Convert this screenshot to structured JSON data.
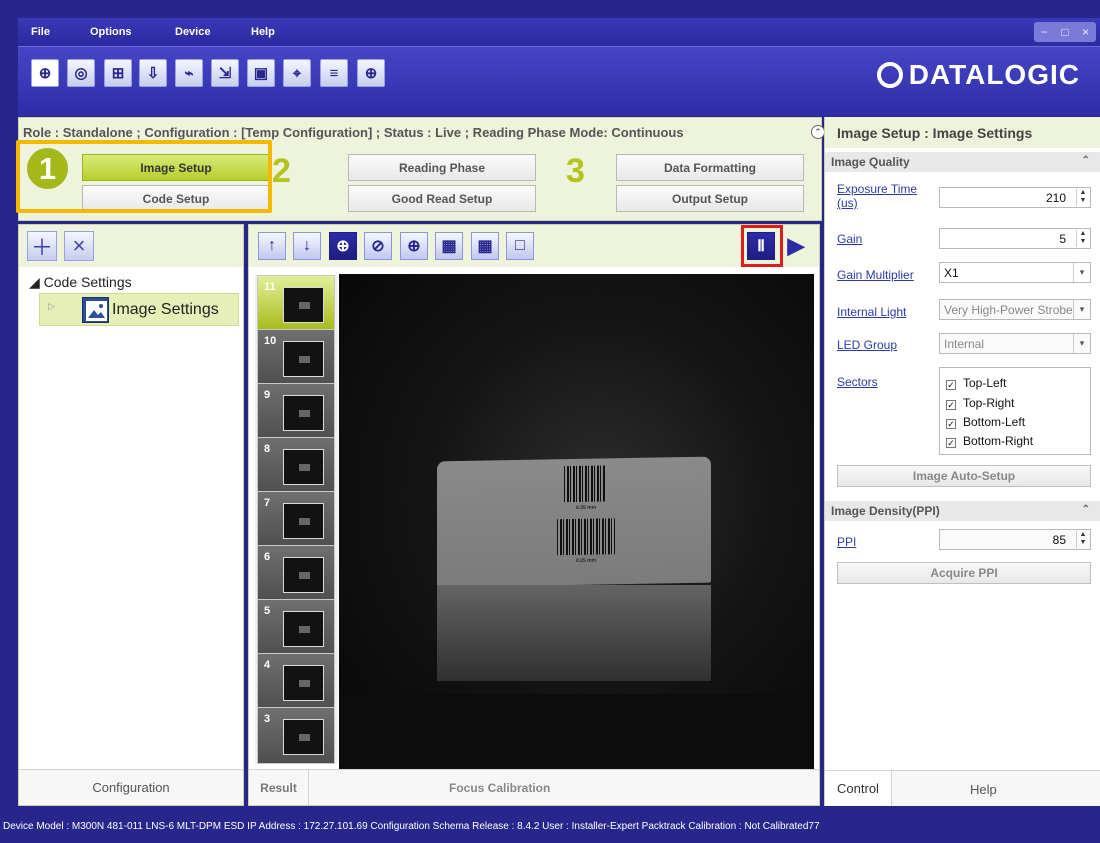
{
  "menu": [
    "File",
    "Options",
    "Device",
    "Help"
  ],
  "toolbar": {
    "icons": [
      "connect-icon",
      "camera-icon",
      "add-image-icon",
      "download-image-icon",
      "save-image-icon",
      "export-icon",
      "settings-icon",
      "camera-settings-icon",
      "diagnostics-icon",
      "target-icon"
    ],
    "logo": "DATALOGIC"
  },
  "role_line": "Role : Standalone ; Configuration : [Temp Configuration] ; Status : Live ; Reading Phase Mode: Continuous",
  "steps": {
    "step1": {
      "number": "1",
      "primary": "Image Setup",
      "secondary": "Code Setup"
    },
    "step2": {
      "number": "2",
      "primary": "Reading Phase",
      "secondary": "Good Read Setup"
    },
    "step3": {
      "number": "3",
      "primary": "Data Formatting",
      "secondary": "Output Setup"
    }
  },
  "left_panel": {
    "tree_root": "◢ Code Settings",
    "tree_child": "Image Settings",
    "footer": "Configuration"
  },
  "center_panel": {
    "thumb_labels": [
      "11",
      "10",
      "9",
      "8",
      "7",
      "6",
      "5",
      "4",
      "3"
    ],
    "tabs": {
      "result": "Result",
      "focus": "Focus Calibration"
    },
    "barcode_labels": [
      "0.35 mm",
      "0.25 mm"
    ]
  },
  "right_panel": {
    "title": "Image Setup : Image Settings",
    "image_quality": {
      "title": "Image Quality",
      "exposure_label": "Exposure Time (us)",
      "exposure_value": "210",
      "gain_label": "Gain",
      "gain_value": "5",
      "gain_multiplier_label": "Gain Multiplier",
      "gain_multiplier_value": "X1",
      "internal_light_label": "Internal Light",
      "internal_light_value": "Very High-Power Strobe",
      "led_group_label": "LED Group",
      "led_group_value": "Internal",
      "sectors_label": "Sectors",
      "sectors": [
        "Top-Left",
        "Top-Right",
        "Bottom-Left",
        "Bottom-Right"
      ],
      "auto_setup": "Image Auto-Setup"
    },
    "image_density": {
      "title": "Image Density(PPI)",
      "ppi_label": "PPI",
      "ppi_value": "85",
      "acquire": "Acquire PPI"
    },
    "tabs": {
      "control": "Control",
      "help": "Help"
    }
  },
  "status": "Device Model : M300N  481-011  LNS-6 MLT-DPM ESD  IP Address : 172.27.101.69  Configuration Schema Release : 8.4.2  User : Installer-Expert  Packtrack Calibration : Not Calibrated77"
}
